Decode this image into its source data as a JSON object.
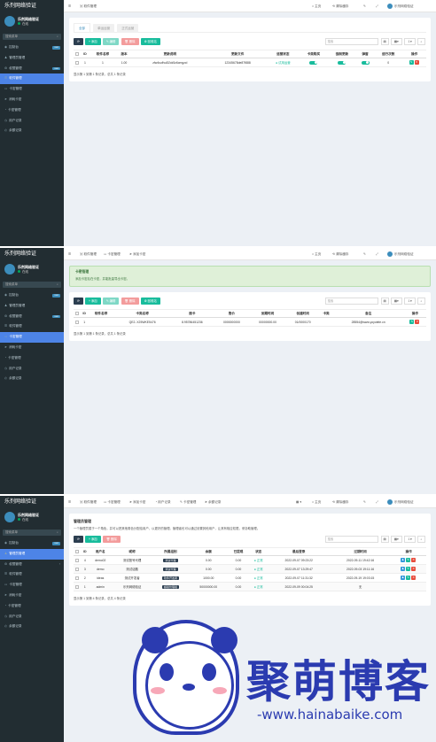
{
  "brand": "乐剂网络验证",
  "user": {
    "name": "乐剂网络验证",
    "status": "在线"
  },
  "search_placeholder": "搜索菜单",
  "menu": [
    {
      "label": "控制台",
      "icon": "◉",
      "badge": "new"
    },
    {
      "label": "管理员管理",
      "icon": "♟"
    },
    {
      "label": "权限管理",
      "icon": "⚙",
      "badge": "new"
    },
    {
      "label": "软件管理",
      "icon": "☰"
    },
    {
      "label": "卡密管理",
      "icon": "▭"
    },
    {
      "label": "消耗卡密",
      "icon": "➤"
    },
    {
      "label": "卡密管理",
      "icon": "◔"
    },
    {
      "label": "用户记录",
      "icon": "◷"
    },
    {
      "label": "余额记录",
      "icon": "◴"
    }
  ],
  "topbar": {
    "home": "主页",
    "clear": "清除缓存",
    "user": "乐剂网络验证"
  },
  "p1": {
    "tabs": [
      "全部",
      "单运运营",
      "正式运营"
    ],
    "btn_add": "+ 添加",
    "btn_edit": "✎ 编辑",
    "btn_del": "🗑 删除",
    "btn_more": "⚙ 回收站",
    "search": "搜索",
    "headers": [
      "ID",
      "软件名称",
      "版本",
      "更新说明",
      "更新文件",
      "运营状态",
      "卡类购买",
      "强制更新",
      "弹窗",
      "运行次数",
      "操作"
    ],
    "row": {
      "id": "1",
      "name": "1",
      "version": "1.00",
      "desc": "zfw4sufhu0l2ck5z6cmgzcl",
      "file": "12345678de87f888",
      "status": "试用运营",
      "count": "0"
    },
    "footer": "显示第 1 到第 1 条记录，总共 1 条记录"
  },
  "p2": {
    "tab": "卡密管理",
    "breadcrumbs": [
      "软件管理",
      "卡密管理",
      "添加卡密"
    ],
    "alert_title": "卡密管理",
    "alert_desc": "添加卡密后在卡密，并能批量导出卡密。",
    "btn_add": "+ 添加",
    "btn_edit": "✎ 编辑",
    "btn_del": "🗑 删除",
    "btn_more": "⚙ 回收站",
    "search": "搜索",
    "headers": [
      "ID",
      "软件名称",
      "卡类名称",
      "面卡",
      "售价",
      "到期时间",
      "创建时间",
      "卡类",
      "备注",
      "操作"
    ],
    "row": {
      "id": "1",
      "name": "",
      "card": "QE2..X25WKE5476",
      "price": "8.95786451236",
      "days": "0000000000",
      "expire": "00000000.00",
      "ctime": "01/0000170",
      "kind": "",
      "note": "28554@www.yoyotele.cn"
    },
    "footer": "显示第 1 到第 1 条记录，总共 1 条记录"
  },
  "p3": {
    "breadcrumbs": [
      "软件管理",
      "卡密管理",
      "添加卡密",
      "用户记录",
      "卡密管理",
      "余额记录"
    ],
    "title": "管理员管理",
    "desc": "一个管理员属于一个角色，并可以把其他角色分配给用户，以更好的管理。管理者也可以通过设置其他用户，让其有相应权限，来协助管理。",
    "btn_add": "+ 添加",
    "btn_del": "🗑 删除",
    "search": "搜索",
    "headers": [
      "ID",
      "用户名",
      "昵称",
      "所属组别",
      "余额",
      "已提现",
      "状态",
      "最后登录",
      "过期时间",
      "操作"
    ],
    "rows": [
      {
        "id": "4",
        "user": "demo02",
        "nick": "测试账号代理",
        "group": "测试代理",
        "bal": "0.00",
        "wd": "0.00",
        "status": "正常",
        "login": "2022-09-07 09:23:22",
        "exp": "2022-09-11 19:42:16"
      },
      {
        "id": "3",
        "user": "demo",
        "nick": "测试话题",
        "group": "测试代理",
        "bal": "0.00",
        "wd": "0.00",
        "status": "正常",
        "login": "2022-09-07 13:29:47",
        "exp": "2022-09-03 19:11:16"
      },
      {
        "id": "2",
        "user": "ideas",
        "nick": "测试开发者",
        "group": "软件开发者",
        "bal": "1000.00",
        "wd": "0.00",
        "status": "正常",
        "login": "2022-09-07 11:31:32",
        "exp": "2022-09-19 19:03:15"
      },
      {
        "id": "1",
        "user": "admin",
        "nick": "乐剂网络验证",
        "group": "超级管理组",
        "bal": "50000000.00",
        "wd": "0.00",
        "status": "正常",
        "login": "2022-09-09 00:04:25",
        "exp": "无"
      }
    ],
    "footer": "显示第 1 到第 4 条记录，总共 4 条记录"
  },
  "watermark": {
    "text": "聚萌博客",
    "url": "-www.hainabaike.com"
  }
}
